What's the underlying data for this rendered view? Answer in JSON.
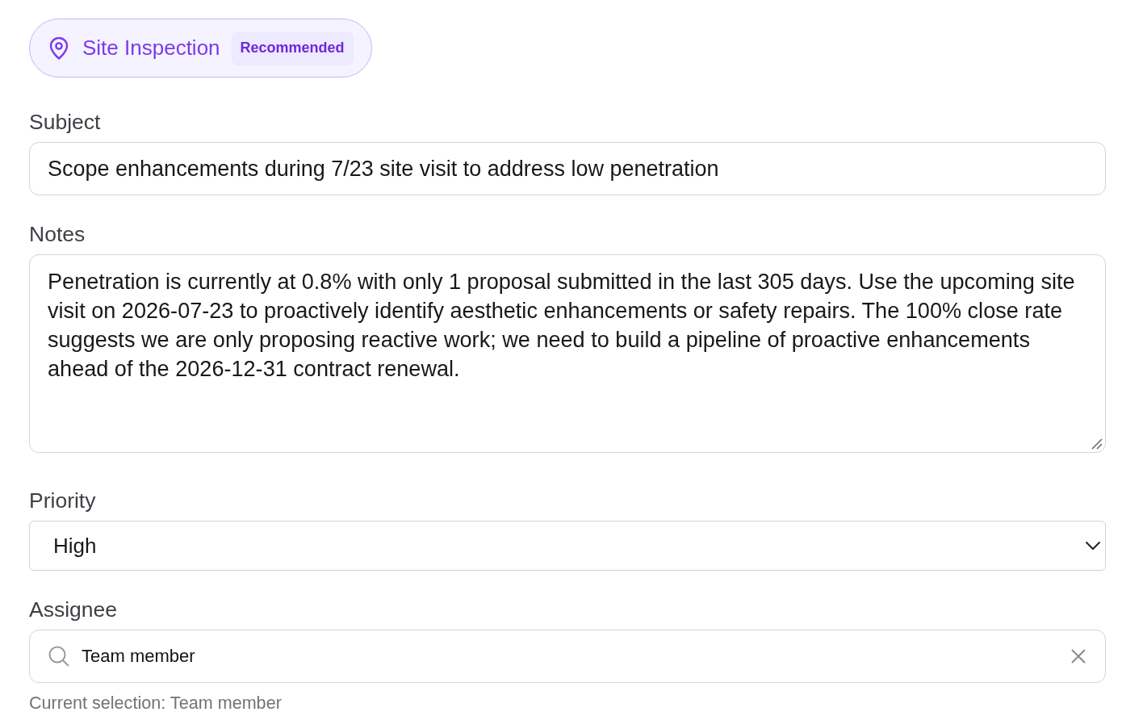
{
  "recommendation": {
    "label": "Site Inspection",
    "badge": "Recommended"
  },
  "fields": [
    {
      "kind": "text",
      "label": "Subject",
      "value": "Scope enhancements during 7/23 site visit to address low penetration"
    },
    {
      "kind": "textarea",
      "label": "Notes",
      "value": "Penetration is currently at 0.8% with only 1 proposal submitted in the last 305 days. Use the upcoming site visit on 2026-07-23 to proactively identify aesthetic enhancements or safety repairs. The 100% close rate suggests we are only proposing reactive work; we need to build a pipeline of proactive enhancements ahead of the 2026-12-31 contract renewal."
    },
    {
      "kind": "select",
      "label": "Priority",
      "value": "High"
    },
    {
      "kind": "search",
      "label": "Assignee",
      "value": "Team member",
      "helper": "Current selection: Team member"
    }
  ]
}
